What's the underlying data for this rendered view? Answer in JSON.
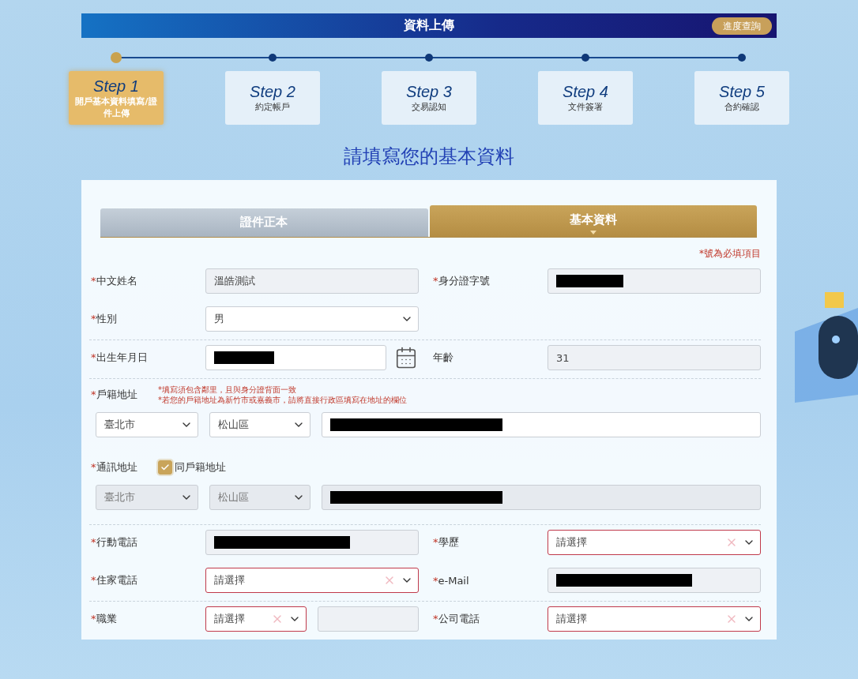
{
  "header": {
    "title": "資料上傳",
    "progress_button": "進度查詢"
  },
  "steps": [
    {
      "step": "Step 1",
      "label": "開戶基本資料填寫/證件上傳",
      "selected": true
    },
    {
      "step": "Step 2",
      "label": "約定帳戶",
      "selected": false
    },
    {
      "step": "Step 3",
      "label": "交易認知",
      "selected": false
    },
    {
      "step": "Step 4",
      "label": "文件簽署",
      "selected": false
    },
    {
      "step": "Step 5",
      "label": "合約確認",
      "selected": false
    }
  ],
  "heading": "請填寫您的基本資料",
  "tabs": [
    {
      "label": "證件正本",
      "selected": false
    },
    {
      "label": "基本資料",
      "selected": true
    }
  ],
  "required_note": "*號為必填項目",
  "sections": [
    {
      "kind": "pairs",
      "rows": [
        [
          {
            "mark": "*",
            "label": "中文姓名",
            "kind": "readonly",
            "value": "溫皓測試"
          },
          {
            "mark": "*",
            "label": "身分證字號",
            "kind": "readonly",
            "redacted": true
          }
        ],
        [
          {
            "mark": "*",
            "label": "性別",
            "kind": "select",
            "value": "男"
          }
        ]
      ]
    },
    {
      "kind": "pairs",
      "rows": [
        [
          {
            "mark": "*",
            "label": "出生年月日",
            "kind": "date",
            "redacted": true
          },
          {
            "label": "年齡",
            "kind": "readonly",
            "value": "31"
          }
        ]
      ]
    },
    {
      "kind": "address",
      "rows": [
        {
          "mark": "*",
          "label": "戶籍地址",
          "notes": [
            "*填寫須包含鄰里，且與身分證背面一致",
            "*若您的戶籍地址為新竹市或嘉義市，請將直接行政區填寫在地址的欄位"
          ],
          "city": "臺北市",
          "district": "松山區",
          "disabled": false
        },
        {
          "mark": "*",
          "label": "通訊地址",
          "same_as": {
            "label": "同戶籍地址",
            "checked": true
          },
          "city": "臺北市",
          "district": "松山區",
          "disabled": true
        }
      ]
    },
    {
      "kind": "pairs",
      "rows": [
        [
          {
            "mark": "*",
            "label": "行動電話",
            "kind": "readonly",
            "redacted": true
          },
          {
            "mark": "*",
            "label": "學歷",
            "kind": "select",
            "placeholder": "請選擇",
            "invalid": true
          }
        ],
        [
          {
            "mark": "*",
            "label": "住家電話",
            "kind": "select",
            "placeholder": "請選擇",
            "invalid": true
          },
          {
            "mark": "*",
            "label": "e-Mail",
            "kind": "readonly",
            "redacted": true
          }
        ]
      ]
    },
    {
      "kind": "pairs",
      "rows": [
        [
          {
            "mark": "*",
            "label": "職業",
            "kind": "select_extra",
            "placeholder": "請選擇",
            "invalid": true
          },
          {
            "mark": "*",
            "label": "公司電話",
            "kind": "select",
            "placeholder": "請選擇",
            "invalid": true
          }
        ]
      ]
    }
  ]
}
